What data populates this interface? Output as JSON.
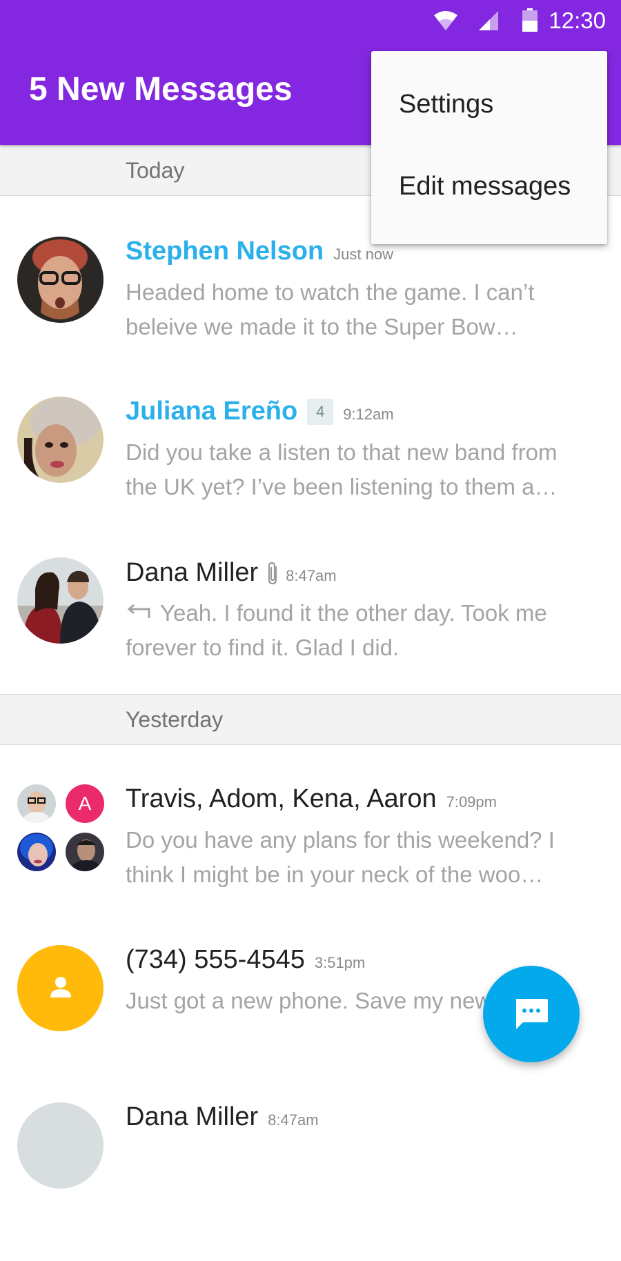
{
  "status_bar": {
    "time": "12:30"
  },
  "app_bar": {
    "title": "5 New Messages"
  },
  "overflow_menu": {
    "items": [
      "Settings",
      "Edit messages"
    ]
  },
  "sections": [
    {
      "label": "Today"
    },
    {
      "label": "Yesterday"
    }
  ],
  "conversations": [
    {
      "name": "Stephen Nelson",
      "time": "Just now",
      "preview": "Headed home to watch the game. I can’t beleive we made it to the Super Bow…",
      "unread": true
    },
    {
      "name": "Juliana Ereño",
      "badge": "4",
      "time": "9:12am",
      "preview": "Did you take a listen to that new band from the UK yet? I’ve been listening to them a…",
      "unread": true
    },
    {
      "name": "Dana Miller",
      "time": "8:47am",
      "preview": "Yeah. I found it the other day. Took me forever to find it. Glad I did.",
      "unread": false,
      "has_attachment": true,
      "replied": true
    },
    {
      "name": "Travis, Adom, Kena, Aaron",
      "time": "7:09pm",
      "preview": "Do you have any plans for this weekend? I think I might be in your neck of the woo…",
      "unread": false,
      "group_initial": "A"
    },
    {
      "name": "(734) 555-4545",
      "time": "3:51pm",
      "preview": "Just got a new phone. Save my new number.",
      "unread": false
    },
    {
      "name": "Dana Miller",
      "time": "8:47am",
      "preview": "",
      "unread": false
    }
  ],
  "colors": {
    "app_bar": "#8427e0",
    "unread_name": "#2ab0ea",
    "fab": "#04a9ec",
    "unknown_contact_avatar": "#ffba0c",
    "group_initial_avatar": "#eb2a6a"
  },
  "icons": {
    "wifi": "wifi-icon",
    "signal": "cell-signal-icon",
    "battery": "battery-icon",
    "attachment": "paperclip-icon",
    "reply": "reply-arrow-icon",
    "person": "person-icon",
    "compose": "chat-bubble-icon"
  }
}
